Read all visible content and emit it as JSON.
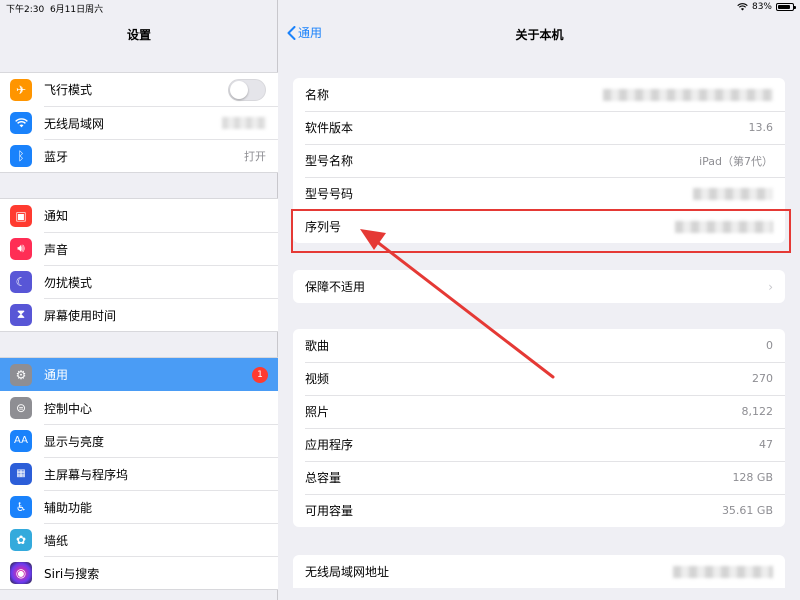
{
  "status": {
    "time": "下午2:30",
    "date": "6月11日周六",
    "battery": "83%",
    "battery_level": 0.83
  },
  "left": {
    "title": "设置",
    "groups": [
      [
        {
          "label": "飞行模式",
          "icon": "airplane-icon",
          "color": "#ff9500"
        },
        {
          "label": "无线局域网",
          "icon": "wifi-icon",
          "color": "#1a82fb"
        },
        {
          "label": "蓝牙",
          "icon": "bluetooth-icon",
          "color": "#1a82fb",
          "value": "打开"
        }
      ],
      [
        {
          "label": "通知",
          "icon": "notification-icon",
          "color": "#ff3b30"
        },
        {
          "label": "声音",
          "icon": "speaker-icon",
          "color": "#ff2d55"
        },
        {
          "label": "勿扰模式",
          "icon": "moon-icon",
          "color": "#5856d6"
        },
        {
          "label": "屏幕使用时间",
          "icon": "hourglass-icon",
          "color": "#5856d6"
        }
      ],
      [
        {
          "label": "通用",
          "icon": "gear-icon",
          "color": "#8e8e93",
          "badge": "1"
        },
        {
          "label": "控制中心",
          "icon": "switches-icon",
          "color": "#8e8e93"
        },
        {
          "label": "显示与亮度",
          "icon": "text-size-icon",
          "color": "#1a82fb",
          "glyph": "AA"
        },
        {
          "label": "主屏幕与程序坞",
          "icon": "grid-icon",
          "color": "#2c5ed8"
        },
        {
          "label": "辅助功能",
          "icon": "accessibility-icon",
          "color": "#1a82fb"
        },
        {
          "label": "墙纸",
          "icon": "flower-icon",
          "color": "#34aadc"
        },
        {
          "label": "Siri与搜索",
          "icon": "siri-icon",
          "color": "#222222"
        }
      ]
    ]
  },
  "right": {
    "back": "通用",
    "title": "关于本机",
    "group1": [
      {
        "label": "名称"
      },
      {
        "label": "软件版本",
        "value": "13.6"
      },
      {
        "label": "型号名称",
        "value": "iPad（第7代）"
      },
      {
        "label": "型号号码"
      },
      {
        "label": "序列号"
      }
    ],
    "group2": [
      {
        "label": "保障不适用"
      }
    ],
    "group3": [
      {
        "label": "歌曲",
        "value": "0"
      },
      {
        "label": "视频",
        "value": "270"
      },
      {
        "label": "照片",
        "value": "8,122"
      },
      {
        "label": "应用程序",
        "value": "47"
      },
      {
        "label": "总容量",
        "value": "128 GB"
      },
      {
        "label": "可用容量",
        "value": "35.61 GB"
      }
    ],
    "group4": [
      {
        "label": "无线局域网地址"
      }
    ]
  },
  "colors": {
    "accent": "#1a82fb",
    "selected": "#4a9cf5",
    "highlight": "#e53935"
  }
}
